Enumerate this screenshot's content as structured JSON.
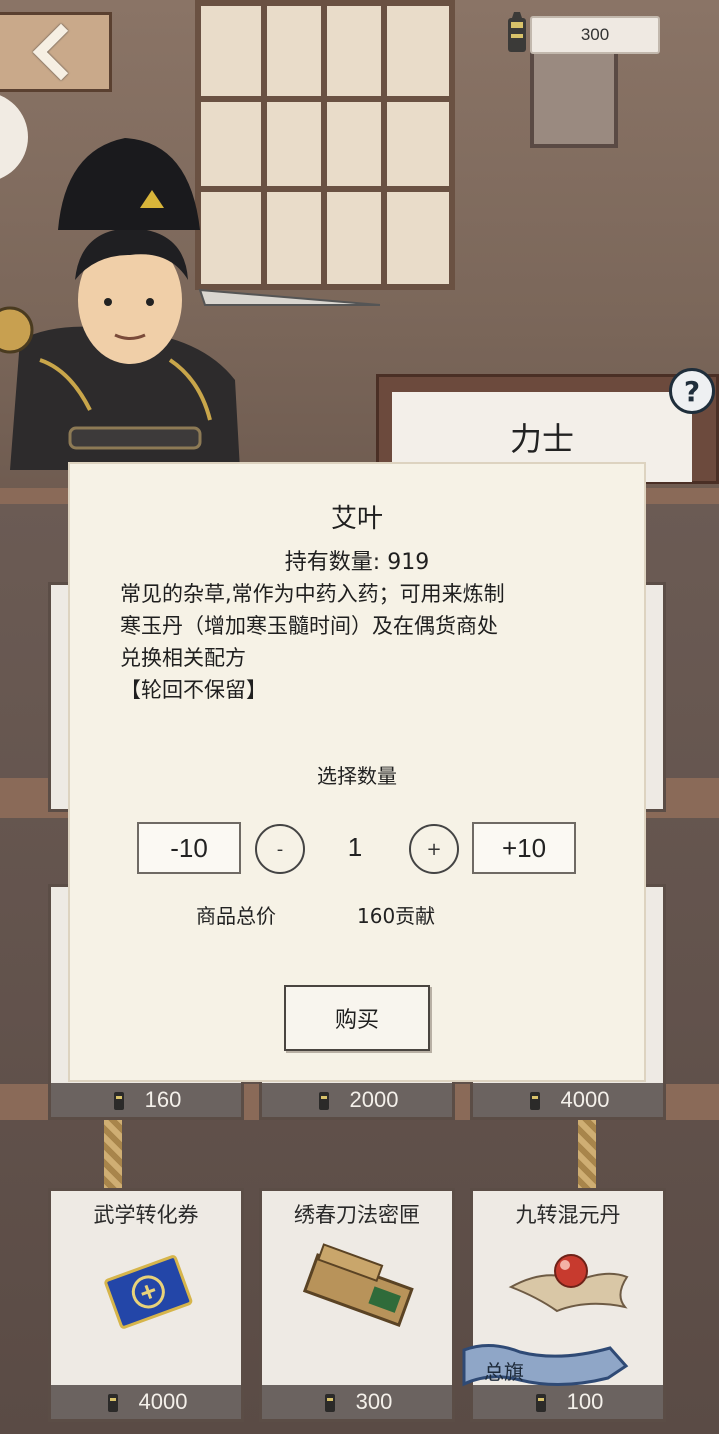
{
  "header": {
    "currency_value": "300"
  },
  "shop": {
    "title": "力士",
    "help_label": "?"
  },
  "shelf_row_1": {
    "prices": [
      "160",
      "2000",
      "4000"
    ]
  },
  "shelf_row_2": {
    "items": [
      {
        "name": "武学转化券",
        "price": "4000"
      },
      {
        "name": "绣春刀法密匣",
        "price": "300"
      },
      {
        "name": "九转混元丹",
        "price": "100"
      }
    ],
    "banner_label": "总旗"
  },
  "modal": {
    "item_name": "艾叶",
    "owned_count": "持有数量: 919",
    "description_lines": [
      "常见的杂草,常作为中药入药；可用来炼制",
      "寒玉丹（增加寒玉髓时间）及在偶货商处",
      "兑换相关配方",
      "【轮回不保留】"
    ],
    "select_label": "选择数量",
    "minus10_label": "-10",
    "minus_label": "-",
    "quantity": "1",
    "plus_label": "+",
    "plus10_label": "+10",
    "total_label": "商品总价",
    "total_value": "160贡献",
    "buy_label": "购买"
  }
}
